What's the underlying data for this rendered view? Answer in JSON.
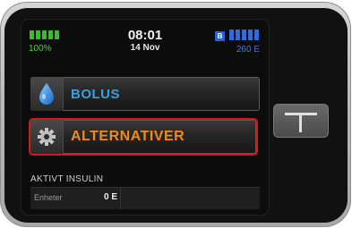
{
  "status": {
    "battery_percent": "100%",
    "time": "08:01",
    "date": "14 Nov",
    "bluetooth_badge": "B",
    "reservoir_units": "260 E"
  },
  "menu": {
    "bolus_label": "BOLUS",
    "alternatives_label": "ALTERNATIVER"
  },
  "active_insulin": {
    "title": "AKTIVT INSULIN",
    "units_label": "Enheter",
    "units_value": "0 E"
  },
  "colors": {
    "battery": "#3bbb2f",
    "reservoir": "#2f6ae0",
    "bolus_text": "#3a9fe0",
    "alternatives_text": "#f08a1c",
    "selection_border": "#d11a1a"
  },
  "icons": {
    "bolus": "drop-icon",
    "alternatives": "gear-icon",
    "hardware_button": "t-button-icon"
  }
}
